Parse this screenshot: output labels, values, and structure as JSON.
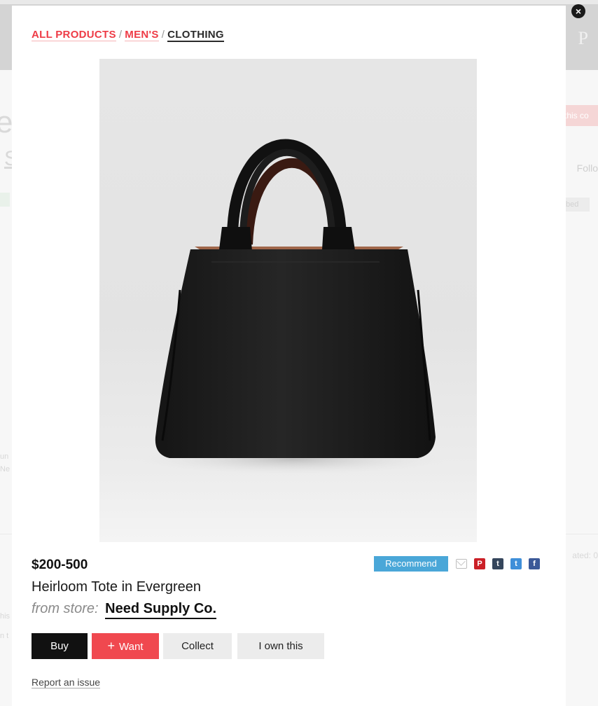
{
  "background": {
    "brand_text": "P P",
    "left_letter": "e",
    "left_s": "S",
    "right_button": "this co",
    "right_follow": "Follo",
    "right_sub": "bed",
    "right_dated": "ated: 0",
    "left_small_1": "un",
    "left_small_2": "Ne",
    "left_small_3": "his",
    "left_small_4": "n t"
  },
  "modal": {
    "close_icon": "×",
    "breadcrumb": [
      {
        "label": "ALL PRODUCTS"
      },
      {
        "label": "MEN'S"
      },
      {
        "label": "CLOTHING"
      }
    ],
    "breadcrumb_separator": "/",
    "product": {
      "price": "$200-500",
      "title": "Heirloom Tote in Evergreen",
      "from_label": "from store:",
      "store_name": "Need Supply Co."
    },
    "recommend_label": "Recommend",
    "share": {
      "pinterest": "P",
      "tumblr": "t",
      "twitter": "t",
      "facebook": "f"
    },
    "actions": {
      "buy": "Buy",
      "want_plus": "+",
      "want": "Want",
      "collect": "Collect",
      "own": "I own this"
    },
    "report_label": "Report an issue"
  },
  "colors": {
    "accent_red": "#ee3b46",
    "recommend_blue": "#4aa7d8",
    "want_red": "#f0484f"
  }
}
